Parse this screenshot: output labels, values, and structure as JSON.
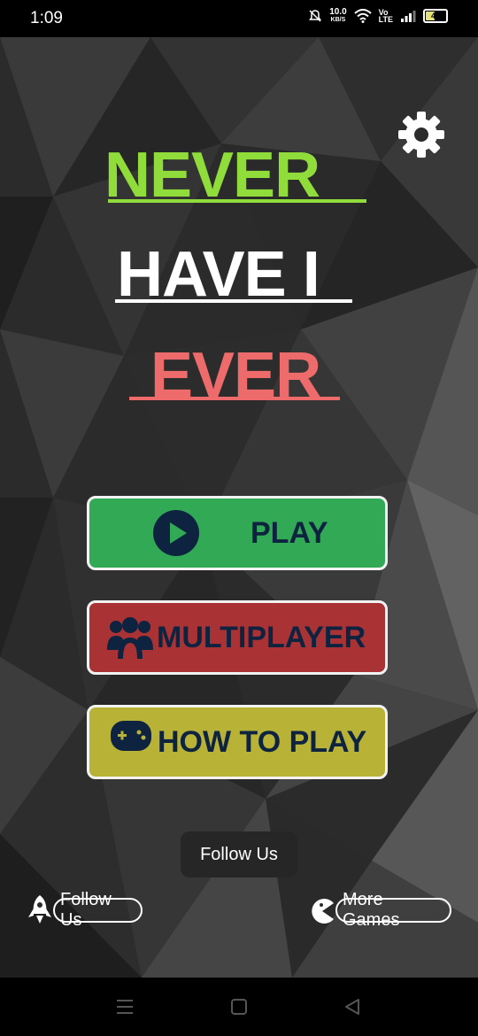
{
  "status_bar": {
    "time": "1:09",
    "speed_value": "10.0",
    "speed_unit": "KB/S",
    "volte_top": "Vo",
    "volte_bottom": "LTE",
    "battery_level": "41"
  },
  "title": {
    "line1": "NEVER",
    "line2": "HAVE I",
    "line3": "EVER"
  },
  "colors": {
    "never": "#8fdc3a",
    "have": "#ffffff",
    "ever": "#ee6b6b",
    "play_button": "#31a955",
    "multiplayer_button": "#a93234",
    "how_to_play_button": "#b8b236",
    "button_text": "#0e2340"
  },
  "buttons": {
    "play": "PLAY",
    "multiplayer": "MULTIPLAYER",
    "how_to_play": "HOW TO PLAY"
  },
  "toast": "Follow Us",
  "bottom_links": {
    "follow_us": "Follow Us",
    "more_games": "More Games"
  },
  "icons": {
    "settings": "gear-icon",
    "play": "play-circle-icon",
    "multiplayer": "group-icon",
    "how_to_play": "gamepad-icon",
    "follow": "rocket-icon",
    "more_games": "pacman-icon"
  }
}
